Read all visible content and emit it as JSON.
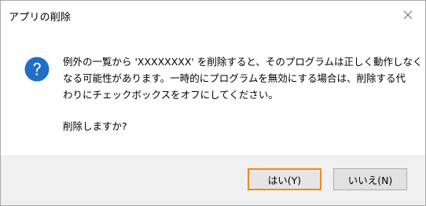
{
  "dialog": {
    "title": "アプリの削除",
    "message_lines": [
      "例外の一覧から 'XXXXXXXX' を削除すると、そのプログラムは正しく動作しなく",
      "なる可能性があります。一時的にプログラムを無効にする場合は、削除する代",
      "わりにチェックボックスをオフにしてください。"
    ],
    "question": "削除しますか?",
    "icon": "question-icon",
    "accent_color": "#1f6fc5"
  },
  "buttons": {
    "yes": "はい(Y)",
    "no": "いいえ(N)"
  }
}
